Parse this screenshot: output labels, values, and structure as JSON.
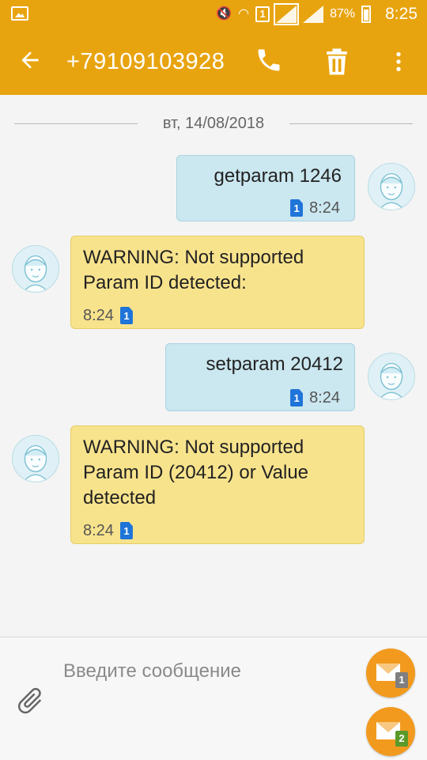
{
  "status_bar": {
    "battery_percent": "87%",
    "time": "8:25",
    "sim_indicator": "1"
  },
  "header": {
    "contact": "+79109103928",
    "icons": [
      "back-arrow-icon",
      "phone-icon",
      "trash-icon",
      "more-vert-icon"
    ]
  },
  "conversation": {
    "date": "вт, 14/08/2018",
    "messages": [
      {
        "direction": "out",
        "text": "getparam 1246",
        "time": "8:24",
        "sim": "1"
      },
      {
        "direction": "in",
        "lines": [
          "WARNING: Not supported",
          "Param ID detected:"
        ],
        "time": "8:24",
        "sim": "1"
      },
      {
        "direction": "out",
        "text": "setparam 20412",
        "time": "8:24",
        "sim": "1"
      },
      {
        "direction": "in",
        "lines": [
          "WARNING: Not supported",
          "Param ID (20412) or Value",
          "detected"
        ],
        "time": "8:24",
        "sim": "1"
      }
    ]
  },
  "composer": {
    "placeholder": "Введите сообщение",
    "send_sim1": "1",
    "send_sim2": "2"
  },
  "colors": {
    "bar": "#e8a40f",
    "outgoing_bubble": "#cbe7f0",
    "incoming_bubble": "#f8e38d",
    "send_button": "#f29a1e",
    "sim1": "#7f7f7f",
    "sim2": "#5a9a2a"
  }
}
